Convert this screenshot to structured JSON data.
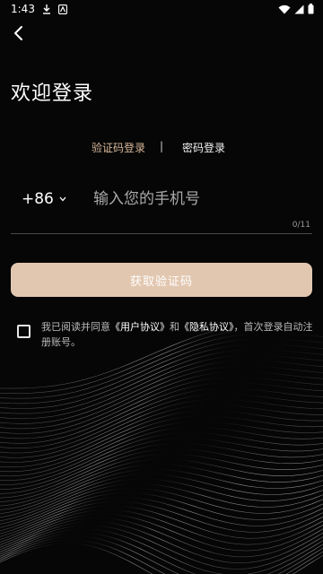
{
  "status_bar": {
    "time": "1:43"
  },
  "title": "欢迎登录",
  "tabs": {
    "sms_login": "验证码登录",
    "divider": "|",
    "password_login": "密码登录"
  },
  "phone": {
    "country_code": "+86",
    "placeholder": "输入您的手机号",
    "counter": "0/11"
  },
  "get_code_button": "获取验证码",
  "agreement": {
    "prefix": "我已阅读并同意",
    "user_agreement": "《用户协议》",
    "and": "和",
    "privacy_policy": "《隐私协议》",
    "suffix": "，首次登录自动注册账号。"
  },
  "colors": {
    "accent": "#d8b89a",
    "button": "#e2c7b0",
    "background": "#060606"
  }
}
